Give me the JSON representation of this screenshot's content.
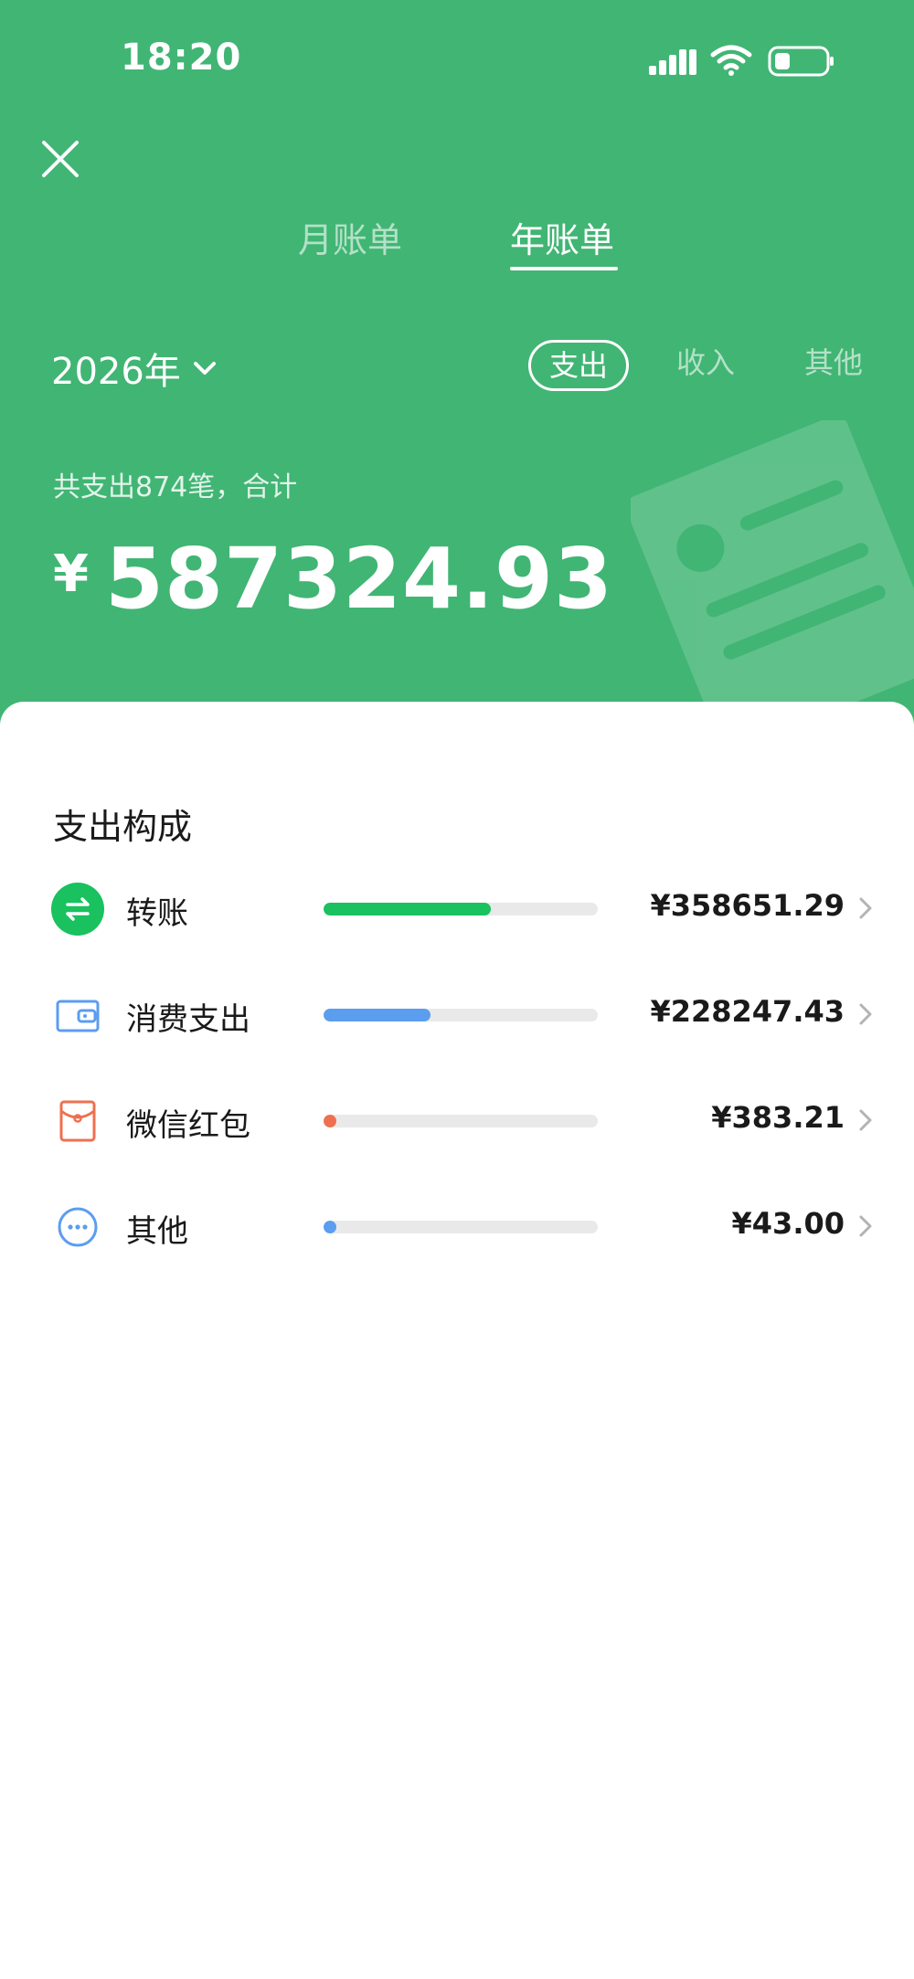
{
  "status_bar": {
    "time": "18:20"
  },
  "header": {
    "tabs": [
      {
        "label": "月账单"
      },
      {
        "label": "年账单"
      }
    ],
    "active_tab": "年账单",
    "year_label": "2026年",
    "type_filters": [
      {
        "label": "支出"
      },
      {
        "label": "收入"
      },
      {
        "label": "其他"
      }
    ],
    "active_type": "支出",
    "summary_label": "共支出874笔，合计",
    "currency_symbol": "¥",
    "total_amount": "587324.93"
  },
  "breakdown": {
    "title": "支出构成",
    "items": [
      {
        "label": "转账",
        "icon": "transfer-icon",
        "amount": "¥358651.29",
        "share": 0.61,
        "color": "#19c15f"
      },
      {
        "label": "消费支出",
        "icon": "wallet-icon",
        "amount": "¥228247.43",
        "share": 0.39,
        "color": "#5b9def"
      },
      {
        "label": "微信红包",
        "icon": "red-packet-icon",
        "amount": "¥383.21",
        "share": 0.006,
        "color": "#ee7050"
      },
      {
        "label": "其他",
        "icon": "more-icon",
        "amount": "¥43.00",
        "share": 0.001,
        "color": "#5b9def"
      }
    ]
  },
  "colors": {
    "header_bg": "#41b574",
    "accent_green": "#19c15f",
    "accent_blue": "#5b9def",
    "accent_red": "#ee7050"
  }
}
